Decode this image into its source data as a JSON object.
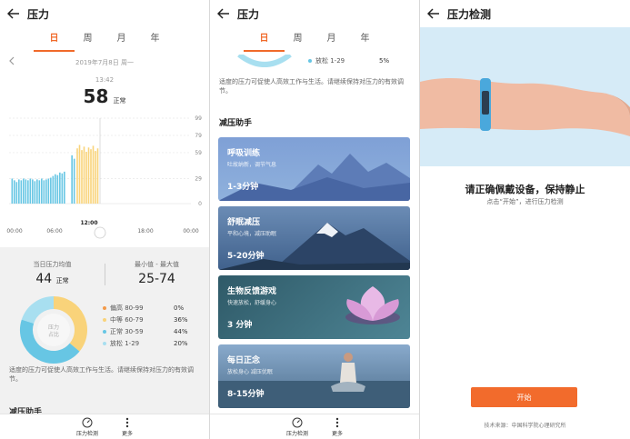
{
  "screen1": {
    "title": "压力",
    "tabs": [
      "日",
      "周",
      "月",
      "年"
    ],
    "active_tab": 0,
    "date": "2019年7月8日 周一",
    "time": "13:42",
    "value": "58",
    "value_label": "正常",
    "stats": {
      "avg_label": "当日压力均值",
      "avg_value": "44",
      "avg_unit": "正常",
      "range_label": "最小值 - 最大值",
      "range_value": "25-74"
    },
    "donut_center": [
      "压力",
      "占比"
    ],
    "legend": [
      {
        "name": "偏高 80-99",
        "pct": "0%",
        "color": "#f39a4a"
      },
      {
        "name": "中等 60-79",
        "pct": "36%",
        "color": "#f9d37a"
      },
      {
        "name": "正常 30-59",
        "pct": "44%",
        "color": "#67c6e4"
      },
      {
        "name": "放松 1-29",
        "pct": "20%",
        "color": "#a8dff0"
      }
    ],
    "description": "适度的压力可促使人高效工作与生活。请继续保持对压力的有效调节。",
    "cut_heading": "减压助手",
    "nav": [
      {
        "label": "压力检测",
        "icon": "gauge-icon"
      },
      {
        "label": "更多",
        "icon": "more-icon"
      }
    ]
  },
  "chart_data": {
    "type": "bar",
    "yticks": [
      0,
      29,
      59,
      79,
      99
    ],
    "xticks": [
      "00:00",
      "06:00",
      "12:00",
      "18:00",
      "00:00"
    ],
    "marker_label": "12:00",
    "ylim": [
      0,
      99
    ],
    "series": [
      {
        "values": [
          {
            "x": 0.4,
            "y": 29,
            "c": "#67c6e4"
          },
          {
            "x": 0.7,
            "y": 27,
            "c": "#67c6e4"
          },
          {
            "x": 1.0,
            "y": 25,
            "c": "#67c6e4"
          },
          {
            "x": 1.3,
            "y": 28,
            "c": "#67c6e4"
          },
          {
            "x": 1.6,
            "y": 27,
            "c": "#67c6e4"
          },
          {
            "x": 1.9,
            "y": 29,
            "c": "#67c6e4"
          },
          {
            "x": 2.2,
            "y": 28,
            "c": "#67c6e4"
          },
          {
            "x": 2.5,
            "y": 27,
            "c": "#67c6e4"
          },
          {
            "x": 2.8,
            "y": 29,
            "c": "#67c6e4"
          },
          {
            "x": 3.1,
            "y": 28,
            "c": "#67c6e4"
          },
          {
            "x": 3.4,
            "y": 26,
            "c": "#67c6e4"
          },
          {
            "x": 3.7,
            "y": 28,
            "c": "#67c6e4"
          },
          {
            "x": 4.0,
            "y": 27,
            "c": "#67c6e4"
          },
          {
            "x": 4.3,
            "y": 29,
            "c": "#67c6e4"
          },
          {
            "x": 4.6,
            "y": 27,
            "c": "#67c6e4"
          },
          {
            "x": 4.9,
            "y": 28,
            "c": "#67c6e4"
          },
          {
            "x": 5.2,
            "y": 29,
            "c": "#67c6e4"
          },
          {
            "x": 5.5,
            "y": 30,
            "c": "#67c6e4"
          },
          {
            "x": 5.8,
            "y": 32,
            "c": "#67c6e4"
          },
          {
            "x": 6.1,
            "y": 34,
            "c": "#67c6e4"
          },
          {
            "x": 6.4,
            "y": 33,
            "c": "#67c6e4"
          },
          {
            "x": 6.7,
            "y": 36,
            "c": "#67c6e4"
          },
          {
            "x": 7.0,
            "y": 35,
            "c": "#67c6e4"
          },
          {
            "x": 7.3,
            "y": 37,
            "c": "#67c6e4"
          },
          {
            "x": 8.3,
            "y": 56,
            "c": "#67c6e4"
          },
          {
            "x": 8.6,
            "y": 52,
            "c": "#67c6e4"
          },
          {
            "x": 9.0,
            "y": 64,
            "c": "#f9d37a"
          },
          {
            "x": 9.3,
            "y": 68,
            "c": "#f9d37a"
          },
          {
            "x": 9.6,
            "y": 62,
            "c": "#f9d37a"
          },
          {
            "x": 9.9,
            "y": 66,
            "c": "#f9d37a"
          },
          {
            "x": 10.2,
            "y": 60,
            "c": "#f9d37a"
          },
          {
            "x": 10.5,
            "y": 65,
            "c": "#f9d37a"
          },
          {
            "x": 10.8,
            "y": 63,
            "c": "#f9d37a"
          },
          {
            "x": 11.1,
            "y": 67,
            "c": "#f9d37a"
          },
          {
            "x": 11.4,
            "y": 61,
            "c": "#f9d37a"
          },
          {
            "x": 11.7,
            "y": 64,
            "c": "#f9d37a"
          }
        ]
      }
    ]
  },
  "screen2": {
    "title": "压力",
    "tabs": [
      "日",
      "周",
      "月",
      "年"
    ],
    "active_tab": 0,
    "partial_legend": {
      "name": "放松 1-29",
      "pct": "5%"
    },
    "description": "适度的压力可促使人高效工作与生活。请继续保持对压力的有效调节。",
    "section": "减压助手",
    "cards": [
      {
        "title": "呼吸训练",
        "sub": "吐故纳新，调节气息",
        "duration": "1-3分钟",
        "bg": "#7f9ed0"
      },
      {
        "title": "舒眠减压",
        "sub": "平和心境，减压助眠",
        "duration": "5-20分钟",
        "bg": "#4c6e96"
      },
      {
        "title": "生物反馈游戏",
        "sub": "快速放松，舒缓身心",
        "duration": "3 分钟",
        "bg": "#3d6b7a"
      },
      {
        "title": "每日正念",
        "sub": "放松身心 减压优眠",
        "duration": "8-15分钟",
        "bg": "#6f90b4"
      }
    ],
    "nav": [
      {
        "label": "压力检测",
        "icon": "gauge-icon"
      },
      {
        "label": "更多",
        "icon": "more-icon"
      }
    ]
  },
  "screen3": {
    "title": "压力检测",
    "heading": "请正确佩戴设备，保持静止",
    "sub": "点击“开始”，进行压力检测",
    "start": "开始",
    "source": "技术来源：中国科学院心理研究所"
  }
}
